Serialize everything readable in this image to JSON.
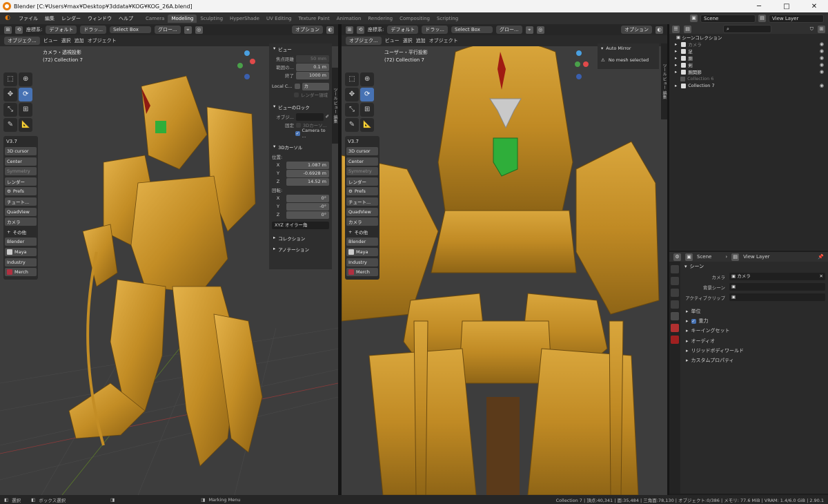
{
  "window": {
    "title": "Blender [C:¥Users¥max¥Desktop¥3ddata¥KOG¥KOG_26A.blend]"
  },
  "menu": {
    "items": [
      "ファイル",
      "編集",
      "レンダー",
      "ウィンドウ",
      "ヘルプ"
    ]
  },
  "workspaces": {
    "tabs": [
      "Camera",
      "Modeling",
      "Sculpting",
      "HyperShade",
      "UV Editing",
      "Texture Paint",
      "Animation",
      "Rendering",
      "Compositing",
      "Scripting"
    ],
    "active": "Modeling"
  },
  "topright": {
    "scene": "Scene",
    "view_layer": "View Layer"
  },
  "header": {
    "coord_label": "座標系:",
    "orientation": "デフォルト",
    "drag": "ドラッ...",
    "select_box": "Select Box",
    "global": "グロー...",
    "options": "オプション",
    "mode": "オブジェク...",
    "menu": [
      "ビュー",
      "選択",
      "追加",
      "オブジェクト"
    ]
  },
  "viewport_left": {
    "info_line1": "カメラ・透視投影",
    "info_line2": "(72) Collection 7"
  },
  "viewport_right": {
    "info_line1": "ユーザー・平行投影",
    "info_line2": "(72) Collection 7"
  },
  "v37": {
    "title": "V3.7",
    "buttons": [
      "3D cursor",
      "Center",
      "Symmetry",
      "レンダー",
      "Prefs",
      "チュート...",
      "QuadView",
      "カメラ",
      "その他",
      "Blender",
      "Maya",
      "Industry",
      "Merch"
    ]
  },
  "npanel": {
    "view_title": "ビュー",
    "focal_label": "焦点距離",
    "focal_value": "50 mm",
    "clip_start_label": "範囲の...",
    "clip_start_value": "0.1 m",
    "clip_end_label": "終了",
    "clip_end_value": "1000 m",
    "local_camera_label": "Local C...",
    "local_camera_field": "カ",
    "render_region": "レンダー領域",
    "lock_title": "ビューのロック",
    "lock_object_label": "オブジ...",
    "lock_label": "固定",
    "lock_3dcursor": "3Dカーソ...",
    "camera_to": "Camera to ...",
    "cursor_title": "3Dカーソル",
    "location_label": "位置:",
    "x_label": "X",
    "y_label": "Y",
    "z_label": "Z",
    "loc_x": "1.087 m",
    "loc_y": "-0.6928 m",
    "loc_z": "14.52 m",
    "rotation_label": "回転:",
    "rot_x": "0°",
    "rot_y": "-0°",
    "rot_z": "0°",
    "euler": "XYZ オイラー角",
    "collection": "コレクション",
    "annotation": "アノテーション",
    "tabs": [
      "ツール",
      "ビュー",
      "編集"
    ]
  },
  "automirror": {
    "title": "Auto Mirror",
    "message": "No mesh selected",
    "tabs": [
      "ツール",
      "ビュー",
      "編集"
    ]
  },
  "outliner": {
    "title": "シーンコレクション",
    "rows": [
      {
        "name": "カメラ",
        "checked": true,
        "visible": true
      },
      {
        "name": "足",
        "checked": true,
        "visible": true
      },
      {
        "name": "胴",
        "checked": true,
        "visible": true
      },
      {
        "name": "剣",
        "checked": true,
        "visible": true
      },
      {
        "name": "腕関節",
        "checked": true,
        "visible": true
      },
      {
        "name": "Collection 6",
        "checked": false,
        "visible": false
      },
      {
        "name": "Collection 7",
        "checked": true,
        "visible": true
      }
    ]
  },
  "properties": {
    "tab_scene": "Scene",
    "tab_view_layer": "View Layer",
    "section": "シーン",
    "camera_label": "カメラ",
    "camera_value": "カメラ",
    "bg_scene_label": "背景シーン",
    "active_clip_label": "アクティブクリップ",
    "subsections": [
      "単位",
      "重力",
      "キーイングセット",
      "オーディオ",
      "リジッドボディワールド",
      "カスタムプロパティ"
    ]
  },
  "status": {
    "select": "選択",
    "box_select": "ボックス選択",
    "marking_menu": "Marking Menu",
    "stats": "Collection 7 | 頂点:40,341 | 面:35,484 | 三角面:78,130 | オブジェクト:0/386 | メモリ: 77.6 MiB | VRAM: 1.4/6.0 GiB | 2.90.1"
  },
  "colors": {
    "accent": "#4772b3",
    "gold": "#c9962e",
    "bg_viewport": "#3d3d3d",
    "header": "#262626"
  }
}
